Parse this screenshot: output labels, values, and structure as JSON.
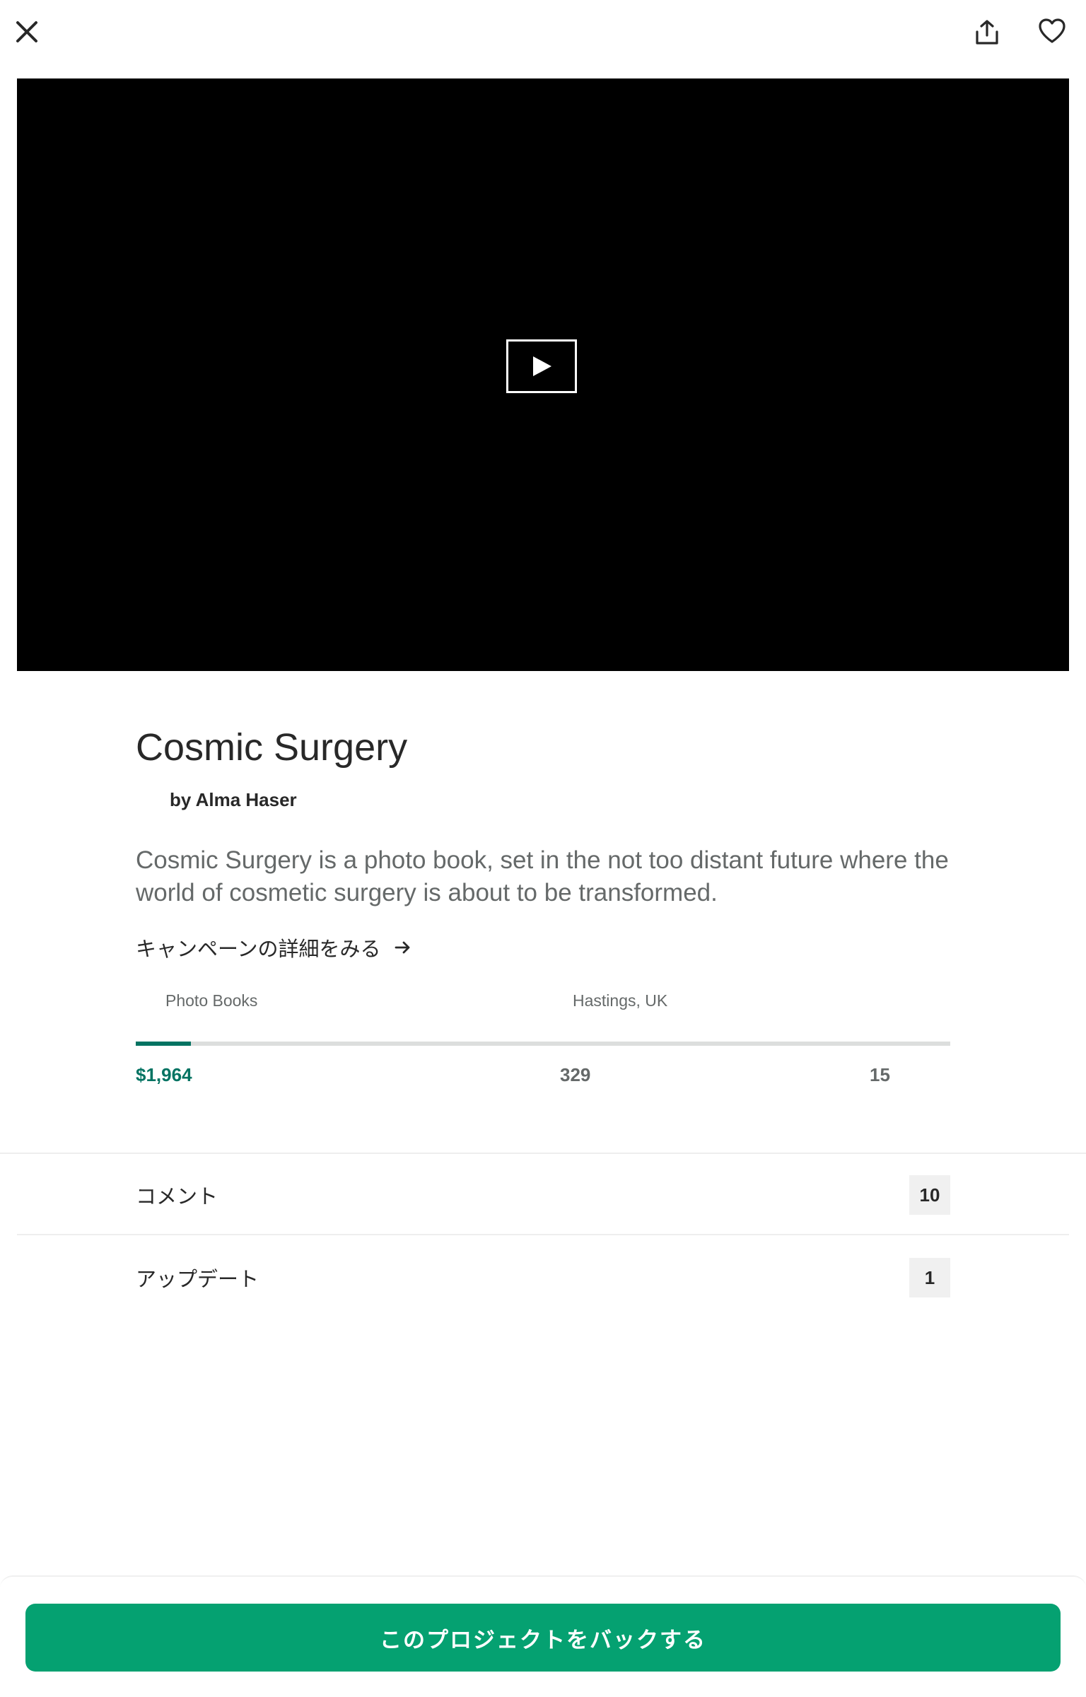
{
  "topbar": {
    "close_icon": "close-icon",
    "share_icon": "share-icon",
    "favorite_icon": "heart-icon"
  },
  "video": {
    "play_icon": "play-icon"
  },
  "project": {
    "title": "Cosmic Surgery",
    "creator": "by Alma Haser",
    "blurb": "Cosmic Surgery is a photo book, set in the not too distant future where the world of cosmetic surgery is about to be transformed.",
    "campaign_link": "キャンペーンの詳細をみる"
  },
  "meta": {
    "category": "Photo Books",
    "location": "Hastings, UK"
  },
  "funding": {
    "progress_fraction": 0.068,
    "pledged": "$1,964",
    "backers": "329",
    "days_left": "15"
  },
  "rows": {
    "comments_label": "コメント",
    "comments_count": "10",
    "updates_label": "アップデート",
    "updates_count": "1"
  },
  "cta": {
    "back_label": "このプロジェクトをバックする"
  },
  "colors": {
    "accent": "#037362",
    "cta": "#05a171",
    "text": "#282828",
    "muted": "#656969"
  }
}
